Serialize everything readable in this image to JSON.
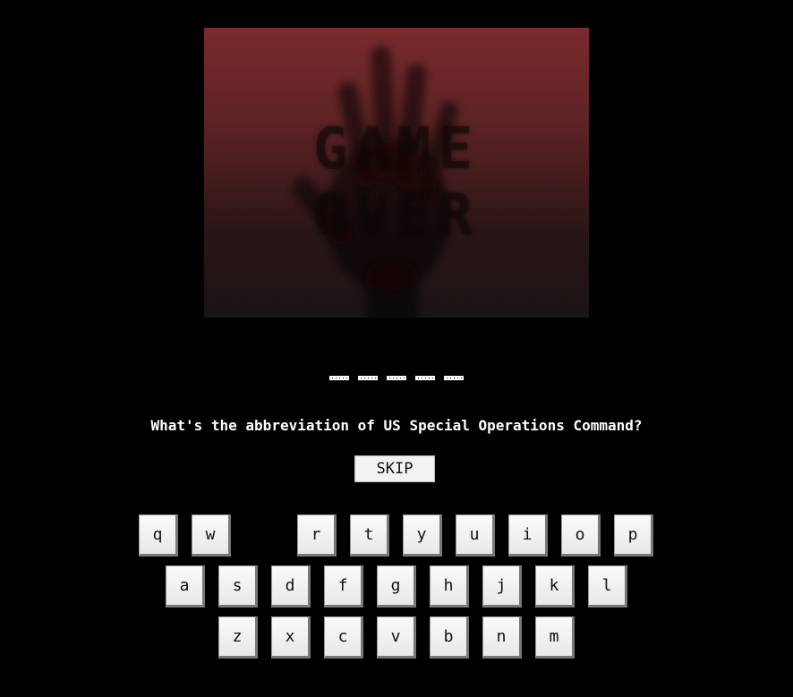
{
  "poster": {
    "text_line1": "GAME",
    "text_line2": "OVER",
    "icon": "hand-silhouette"
  },
  "answer": {
    "blank_count": 5
  },
  "question": "What's the abbreviation of US Special Operations Command?",
  "skip_label": "SKIP",
  "keyboard": {
    "row1": [
      "q",
      "w",
      "r",
      "t",
      "y",
      "u",
      "i",
      "o",
      "p"
    ],
    "row2": [
      "a",
      "s",
      "d",
      "f",
      "g",
      "h",
      "j",
      "k",
      "l"
    ],
    "row3": [
      "z",
      "x",
      "c",
      "v",
      "b",
      "n",
      "m"
    ]
  },
  "colors": {
    "background": "#000000",
    "key": "#f2f2f2",
    "text": "#ffffff",
    "poster_top": "#7a2a2d"
  }
}
